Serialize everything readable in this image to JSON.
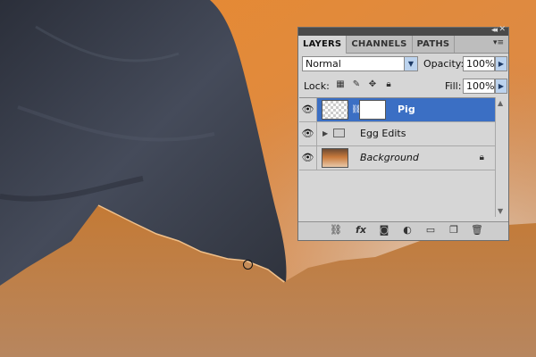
{
  "panel": {
    "tabs": [
      {
        "label": "LAYERS",
        "active": true
      },
      {
        "label": "CHANNELS",
        "active": false
      },
      {
        "label": "PATHS",
        "active": false
      }
    ],
    "blend_mode": "Normal",
    "opacity_label": "Opacity:",
    "opacity_value": "100%",
    "lock_label": "Lock:",
    "fill_label": "Fill:",
    "fill_value": "100%",
    "layers": [
      {
        "name": "Pig",
        "selected": true,
        "has_mask": true
      },
      {
        "name": "Egg Edits",
        "type": "group"
      },
      {
        "name": "Background",
        "locked": true
      }
    ]
  },
  "colors": {
    "selection": "#3b6fc4",
    "panel_bg": "#d6d6d6",
    "eggshell": "#c9762f",
    "pig_fur": "#3c4150"
  },
  "icons": {
    "visibility": "eye-icon",
    "link": "link-icon",
    "effects": "fx-icon",
    "mask": "add-mask-icon",
    "adjustment": "adjustment-layer-icon",
    "group": "new-group-icon",
    "new_layer": "new-layer-icon",
    "delete": "trash-icon"
  }
}
